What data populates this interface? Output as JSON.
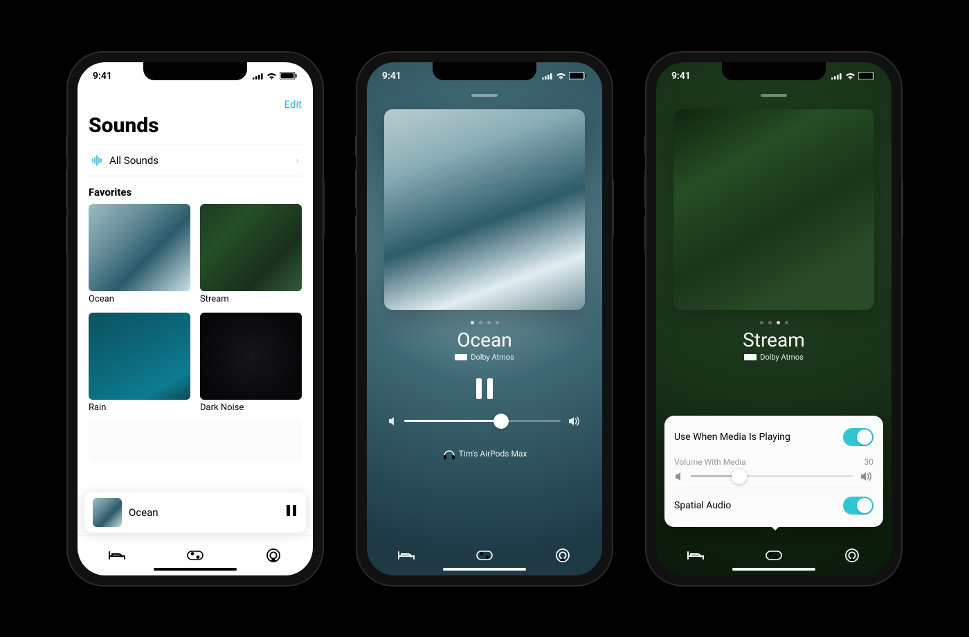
{
  "status_time": "9:41",
  "phone1": {
    "edit": "Edit",
    "title": "Sounds",
    "all_sounds": "All Sounds",
    "favorites": "Favorites",
    "tiles": [
      "Ocean",
      "Stream",
      "Rain",
      "Dark Noise"
    ],
    "now_playing": "Ocean"
  },
  "phone2": {
    "title": "Ocean",
    "atmos": "Dolby Atmos",
    "route": "Tim's AirPods Max",
    "volume_pct": 62,
    "page_active": 1,
    "page_count": 4
  },
  "phone3": {
    "title": "Stream",
    "atmos": "Dolby Atmos",
    "page_active": 3,
    "page_count": 4,
    "use_media_label": "Use When Media Is Playing",
    "use_media_on": true,
    "vol_media_label": "Volume With Media",
    "vol_media_value": 30,
    "vol_media_pct": 30,
    "spatial_label": "Spatial Audio",
    "spatial_on": true
  }
}
